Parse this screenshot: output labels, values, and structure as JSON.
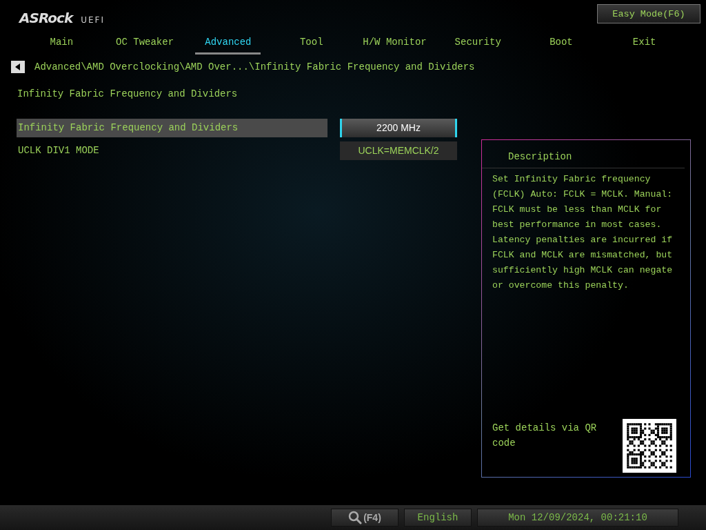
{
  "header": {
    "logo": "ASRock",
    "product": "UEFI",
    "mode_button": "Easy Mode(F6)"
  },
  "tabs": [
    {
      "label": "Main",
      "selected": false
    },
    {
      "label": "OC Tweaker",
      "selected": false
    },
    {
      "label": "Advanced",
      "selected": true
    },
    {
      "label": "Tool",
      "selected": false
    },
    {
      "label": "H/W Monitor",
      "selected": false
    },
    {
      "label": "Security",
      "selected": false
    },
    {
      "label": "Boot",
      "selected": false
    },
    {
      "label": "Exit",
      "selected": false
    }
  ],
  "breadcrumb": "Advanced\\AMD Overclocking\\AMD Over...\\Infinity Fabric Frequency and Dividers",
  "page_title": "Infinity Fabric Frequency and Dividers",
  "settings": [
    {
      "label": "Infinity Fabric Frequency and Dividers",
      "value": "2200 MHz",
      "selected": true
    },
    {
      "label": "UCLK DIV1 MODE",
      "value": "UCLK=MEMCLK/2",
      "selected": false
    }
  ],
  "description": {
    "title": "Description",
    "text": "Set Infinity Fabric frequency (FCLK) Auto: FCLK = MCLK. Manual: FCLK must be less than MCLK for best performance in most cases. Latency penalties are incurred if FCLK and MCLK are mismatched, but sufficiently high MCLK can negate or overcome this penalty.",
    "qr_text": "Get details via QR code"
  },
  "footer": {
    "search_key": "(F4)",
    "language": "English",
    "datetime": "Mon 12/09/2024, 00:21:10"
  }
}
